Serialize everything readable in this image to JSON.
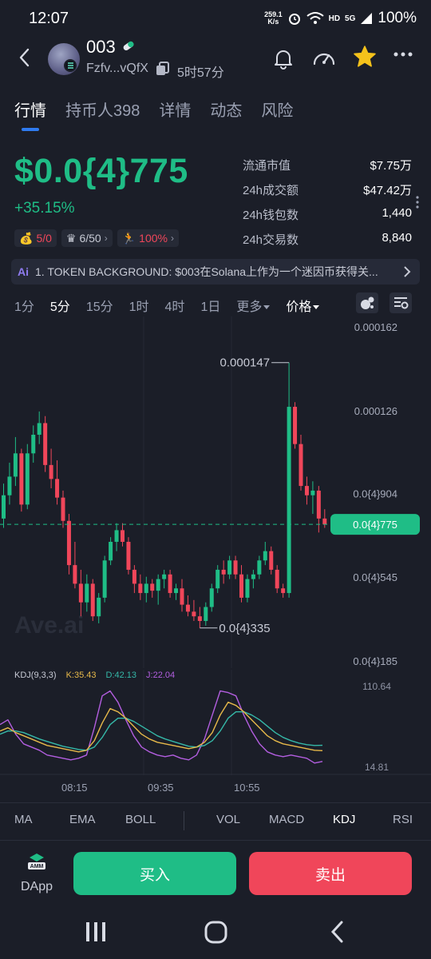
{
  "status_bar": {
    "time": "12:07",
    "net_speed_value": "259.1",
    "net_speed_unit": "K/s",
    "network_labels": [
      "HD",
      "5G"
    ],
    "battery": "100%"
  },
  "header": {
    "token_name": "003",
    "address": "Fzfv...vQfX",
    "age": "5时57分"
  },
  "tabs": [
    {
      "label": "行情",
      "active": true
    },
    {
      "label": "持币人398",
      "active": false
    },
    {
      "label": "详情",
      "active": false
    },
    {
      "label": "动态",
      "active": false
    },
    {
      "label": "风险",
      "active": false
    }
  ],
  "price": {
    "value": "$0.0{4}775",
    "change": "+35.15%"
  },
  "badges": [
    {
      "icon": "money-bag-icon",
      "text": "5/0",
      "color": "#f0465a"
    },
    {
      "icon": "crown-icon",
      "text": "6/50",
      "color": "#c7cad4"
    },
    {
      "icon": "runner-icon",
      "text": "100%",
      "color": "#f0465a"
    }
  ],
  "stats": [
    {
      "label": "流通市值",
      "value": "$7.75万"
    },
    {
      "label": "24h成交额",
      "value": "$47.42万"
    },
    {
      "label": "24h钱包数",
      "value": "1,440"
    },
    {
      "label": "24h交易数",
      "value": "8,840"
    }
  ],
  "ai_bar": {
    "icon_text": "Ai",
    "text": "1. TOKEN BACKGROUND: $003在Solana上作为一个迷因币获得关..."
  },
  "timeframes": [
    {
      "label": "1分",
      "active": false
    },
    {
      "label": "5分",
      "active": true
    },
    {
      "label": "15分",
      "active": false
    },
    {
      "label": "1时",
      "active": false
    },
    {
      "label": "4时",
      "active": false
    },
    {
      "label": "1日",
      "active": false
    },
    {
      "label": "更多",
      "active": false,
      "caret": true
    },
    {
      "label": "价格",
      "active": true,
      "caret": true
    }
  ],
  "chart_data": {
    "type": "candlestick",
    "y_tick_labels": [
      "0.000162",
      "0.000126",
      "0.0{4}904",
      "0.0{4}545",
      "0.0{4}185"
    ],
    "y_ticks": [
      162,
      126,
      90.4,
      54.5,
      18.5
    ],
    "y_unit": "×1e-6",
    "ylim": [
      18.5,
      162
    ],
    "current_price": 77.5,
    "current_price_label": "0.0{4}775",
    "high_label": "0.000147",
    "low_label": "0.0{4}335",
    "watermark": "Ave.ai",
    "candles": [
      [
        80,
        95,
        76,
        90
      ],
      [
        90,
        104,
        86,
        98
      ],
      [
        98,
        115,
        94,
        108
      ],
      [
        108,
        110,
        83,
        86
      ],
      [
        86,
        112,
        84,
        108
      ],
      [
        108,
        120,
        104,
        116
      ],
      [
        116,
        126,
        112,
        121
      ],
      [
        121,
        124,
        100,
        103
      ],
      [
        103,
        110,
        93,
        97
      ],
      [
        97,
        105,
        86,
        89
      ],
      [
        89,
        92,
        76,
        79
      ],
      [
        79,
        82,
        56,
        60
      ],
      [
        60,
        70,
        50,
        52
      ],
      [
        52,
        58,
        38,
        44
      ],
      [
        44,
        56,
        40,
        52
      ],
      [
        52,
        54,
        36,
        38
      ],
      [
        38,
        48,
        35,
        46
      ],
      [
        46,
        64,
        44,
        62
      ],
      [
        62,
        72,
        60,
        70
      ],
      [
        70,
        78,
        66,
        75
      ],
      [
        75,
        78,
        68,
        70
      ],
      [
        70,
        72,
        56,
        58
      ],
      [
        58,
        60,
        48,
        52
      ],
      [
        52,
        56,
        45,
        48
      ],
      [
        48,
        55,
        44,
        52
      ],
      [
        52,
        54,
        46,
        49
      ],
      [
        49,
        56,
        43,
        54
      ],
      [
        54,
        58,
        50,
        56
      ],
      [
        56,
        58,
        46,
        48
      ],
      [
        48,
        52,
        45,
        50
      ],
      [
        50,
        54,
        40,
        43
      ],
      [
        43,
        47,
        38,
        40
      ],
      [
        40,
        45,
        36,
        38
      ],
      [
        38,
        42,
        33,
        36
      ],
      [
        36,
        44,
        34,
        42
      ],
      [
        42,
        52,
        40,
        50
      ],
      [
        50,
        60,
        48,
        58
      ],
      [
        58,
        62,
        52,
        56
      ],
      [
        56,
        64,
        54,
        62
      ],
      [
        62,
        64,
        54,
        56
      ],
      [
        56,
        60,
        44,
        46
      ],
      [
        46,
        56,
        44,
        54
      ],
      [
        54,
        58,
        50,
        56
      ],
      [
        56,
        64,
        54,
        62
      ],
      [
        62,
        70,
        60,
        66
      ],
      [
        66,
        68,
        56,
        58
      ],
      [
        58,
        60,
        48,
        50
      ],
      [
        50,
        52,
        46,
        48
      ],
      [
        48,
        147,
        46,
        128
      ],
      [
        128,
        130,
        110,
        112
      ],
      [
        112,
        116,
        92,
        94
      ],
      [
        94,
        98,
        86,
        90
      ],
      [
        90,
        96,
        82,
        92
      ],
      [
        92,
        94,
        74,
        80
      ],
      [
        80,
        84,
        76,
        77.5
      ]
    ]
  },
  "kdj": {
    "label": "KDJ(9,3,3)",
    "k_label": "K:35.43",
    "d_label": "D:42.13",
    "j_label": "J:22.04",
    "k_color": "#e7b94a",
    "d_color": "#35b8a8",
    "j_color": "#b35ee0",
    "y_max_label": "110.64",
    "y_min_label": "14.81",
    "ylim": [
      14.81,
      110.64
    ],
    "k": [
      60,
      64,
      58,
      54,
      50,
      46,
      42,
      40,
      38,
      36,
      34,
      36,
      48,
      70,
      88,
      84,
      76,
      66,
      56,
      50,
      46,
      44,
      42,
      40,
      38,
      40,
      46,
      58,
      80,
      96,
      92,
      84,
      74,
      64,
      54,
      48,
      44,
      42,
      40,
      38,
      36,
      35.43
    ],
    "d": [
      56,
      60,
      60,
      58,
      54,
      50,
      47,
      44,
      41,
      39,
      37,
      36,
      40,
      52,
      68,
      76,
      76,
      72,
      66,
      60,
      54,
      50,
      47,
      44,
      41,
      40,
      42,
      48,
      60,
      76,
      84,
      84,
      80,
      74,
      66,
      58,
      52,
      48,
      45,
      43,
      42,
      42.13
    ],
    "j": [
      68,
      74,
      56,
      44,
      40,
      36,
      30,
      28,
      26,
      24,
      26,
      30,
      64,
      104,
      110,
      96,
      74,
      54,
      40,
      34,
      30,
      28,
      30,
      26,
      24,
      30,
      50,
      80,
      110,
      108,
      104,
      80,
      60,
      44,
      34,
      30,
      28,
      30,
      28,
      26,
      20,
      22.04
    ]
  },
  "time_axis": [
    "08:15",
    "09:35",
    "10:55"
  ],
  "indicators": [
    {
      "label": "MA",
      "active": false
    },
    {
      "label": "EMA",
      "active": false
    },
    {
      "label": "BOLL",
      "active": false
    },
    {
      "label": "VOL",
      "active": false
    },
    {
      "label": "MACD",
      "active": false
    },
    {
      "label": "KDJ",
      "active": true
    },
    {
      "label": "RSI",
      "active": false
    }
  ],
  "actions": {
    "dapp_badge": "AMM",
    "dapp_label": "DApp",
    "buy_label": "买入",
    "sell_label": "卖出"
  },
  "colors": {
    "up": "#1fbd86",
    "down": "#f0465a",
    "background": "#1b1e28",
    "accent": "#2f7bf0",
    "star": "#f5c21b"
  }
}
